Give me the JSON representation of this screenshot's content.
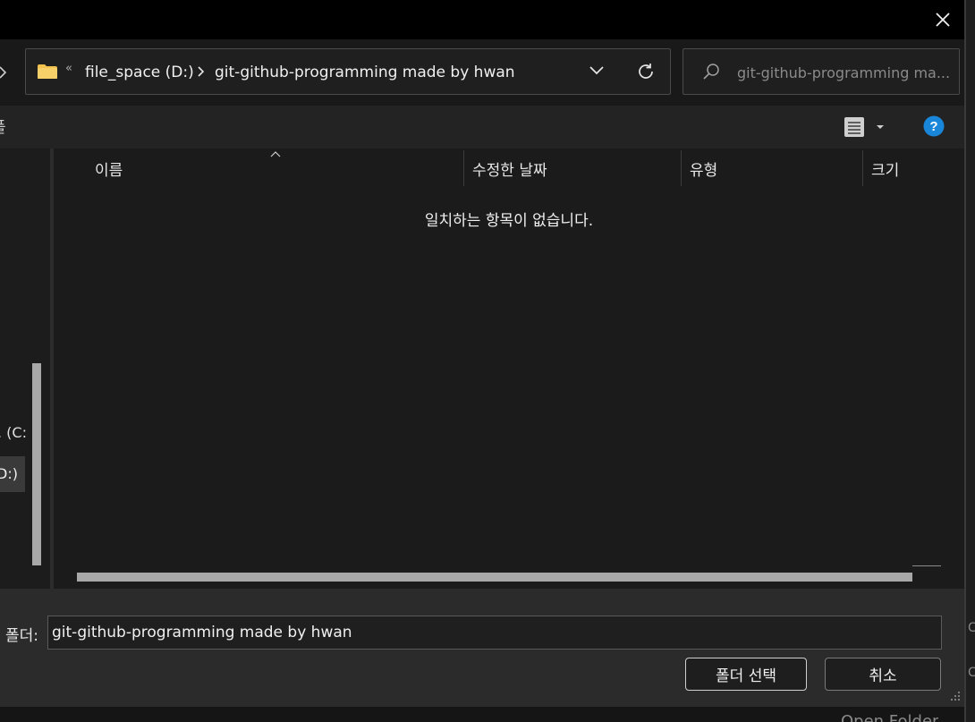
{
  "nav": {
    "breadcrumb_overflow": "«",
    "crumbs": [
      "file_space (D:)",
      "git-github-programming made by hwan"
    ]
  },
  "search": {
    "placeholder": "git-github-programming ma..."
  },
  "toolbar": {
    "left_fragment": "폴"
  },
  "sidebar": {
    "item_c": ". (C:",
    "item_d": "D:)"
  },
  "columns": {
    "name": "이름",
    "modified": "수정한 날짜",
    "type": "유형",
    "size": "크기"
  },
  "empty_message": "일치하는 항목이 없습니다.",
  "footer": {
    "folder_label": "폴더:",
    "folder_value": "git-github-programming made by hwan",
    "select_button": "폴더 선택",
    "cancel_button": "취소"
  },
  "background_window": {
    "text": "Open Folder",
    "edge_glyph_1": "C",
    "edge_glyph_2": "C"
  },
  "colors": {
    "folder_yellow": "#f2c14e",
    "help_blue": "#1a86d9"
  },
  "icons": [
    "close-icon",
    "chevron-left-icon",
    "folder-icon",
    "chevron-right-icon",
    "chevron-down-icon",
    "refresh-icon",
    "search-icon",
    "view-details-icon",
    "dropdown-arrow-icon",
    "help-icon",
    "sort-ascending-icon",
    "resize-grip-icon"
  ]
}
